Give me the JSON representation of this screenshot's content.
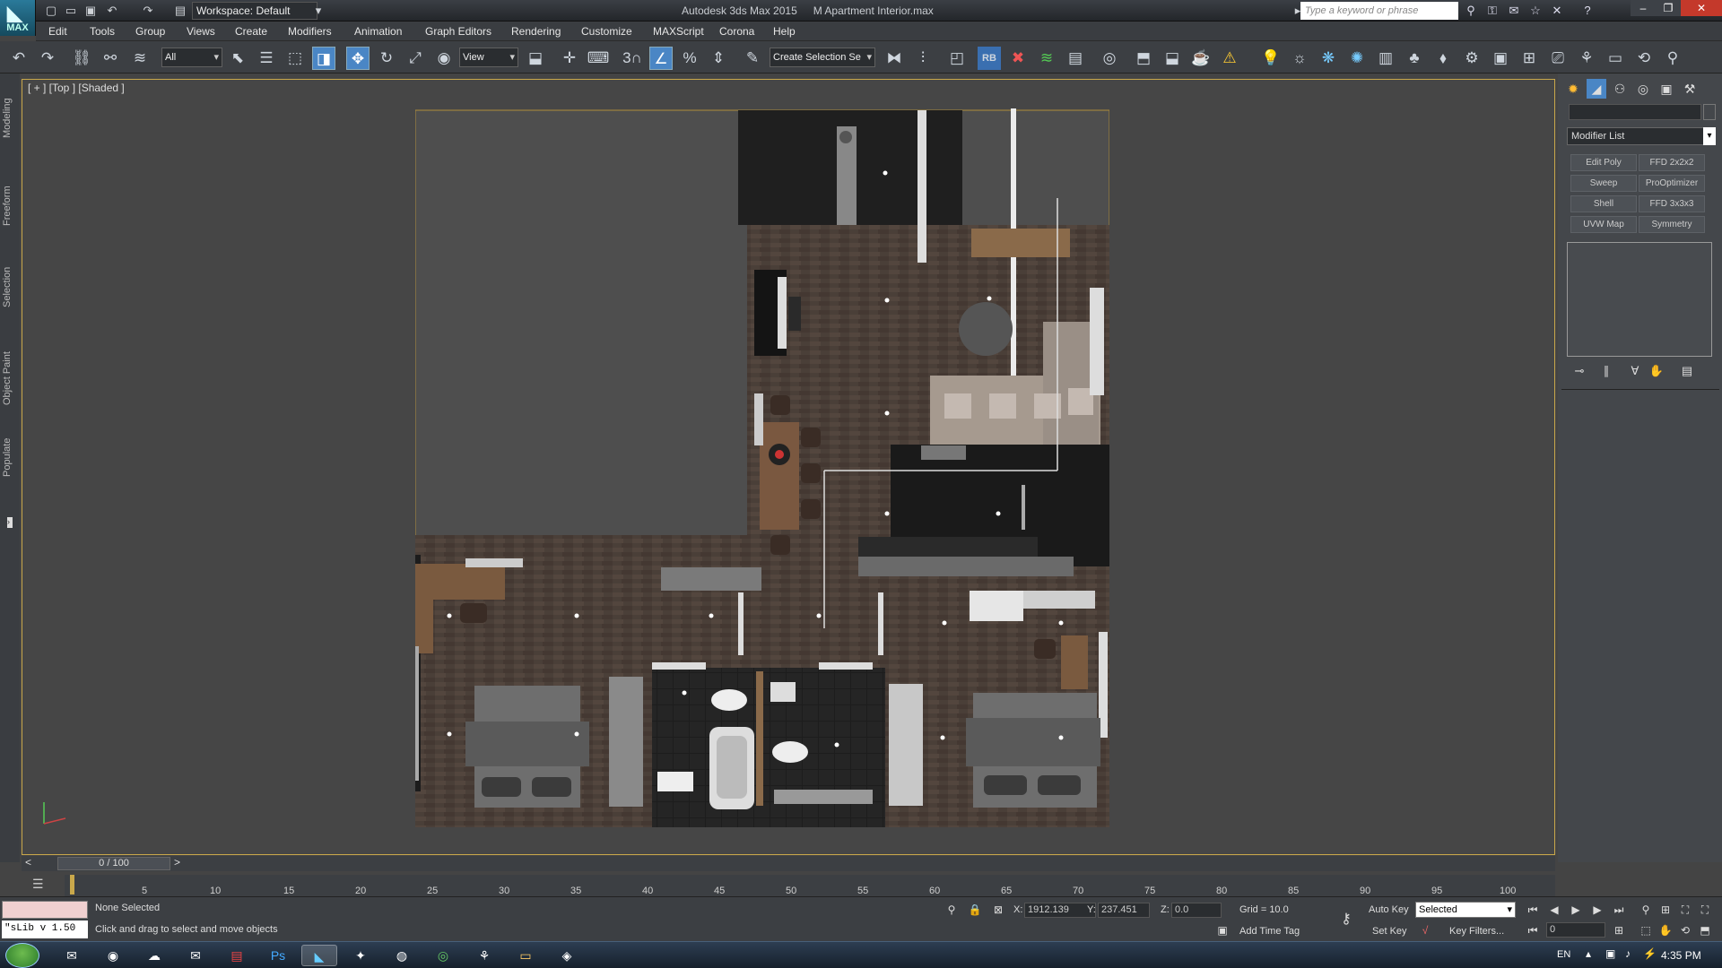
{
  "app": {
    "logo_label": "MAX",
    "title": "Autodesk 3ds Max 2015",
    "file": "M Apartment Interior.max",
    "workspace": "Workspace: Default",
    "search_placeholder": "Type a keyword or phrase"
  },
  "menus": [
    "Edit",
    "Tools",
    "Group",
    "Views",
    "Create",
    "Modifiers",
    "Animation",
    "Graph Editors",
    "Rendering",
    "Customize",
    "MAXScript",
    "Corona",
    "Help"
  ],
  "toolbar": {
    "selection_filter": "All",
    "ref_coord": "View",
    "named_selection": "Create Selection Se",
    "snap_label": "3",
    "rb_label": "RB"
  },
  "left_tabs": [
    "Modeling",
    "Freeform",
    "Selection",
    "Object Paint",
    "Populate"
  ],
  "viewport": {
    "label": "[ + ] [Top ] [Shaded ]"
  },
  "command_panel": {
    "modifier_list": "Modifier List",
    "buttons": [
      "Edit Poly",
      "FFD 2x2x2",
      "Sweep",
      "ProOptimizer",
      "Shell",
      "FFD 3x3x3",
      "UVW Map",
      "Symmetry"
    ]
  },
  "time": {
    "slider": "0 / 100",
    "frame_labels": [
      "5",
      "10",
      "15",
      "20",
      "25",
      "30",
      "35",
      "40",
      "45",
      "50",
      "55",
      "60",
      "65",
      "70",
      "75",
      "80",
      "85",
      "90",
      "95",
      "100"
    ]
  },
  "status": {
    "maxscript": "\"sLib v 1.50",
    "selection": "None Selected",
    "prompt": "Click and drag to select and move objects",
    "x_label": "X:",
    "x": "1912.139",
    "y_label": "Y:",
    "y": "237.451",
    "z_label": "Z:",
    "z": "0.0",
    "grid": "Grid = 10.0",
    "add_time_tag": "Add Time Tag",
    "auto_key": "Auto Key",
    "set_key": "Set Key",
    "selected_dd": "Selected",
    "key_filters": "Key Filters...",
    "frame": "0"
  },
  "taskbar": {
    "lang": "EN",
    "clock": "4:35 PM"
  },
  "colors": {
    "floor": "#4a3f38",
    "viewport_bg": "#464646",
    "accent": "#4a86c5"
  }
}
